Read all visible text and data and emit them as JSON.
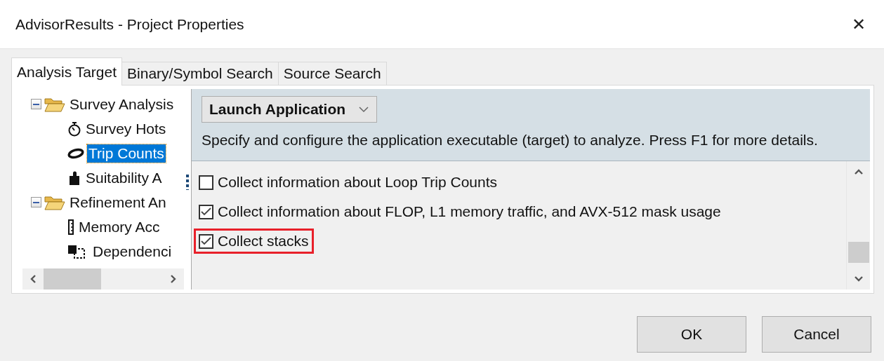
{
  "window": {
    "title": "AdvisorResults - Project Properties",
    "close": "✕"
  },
  "tabs": [
    {
      "label": "Analysis Target",
      "selected": true
    },
    {
      "label": "Binary/Symbol Search",
      "selected": false
    },
    {
      "label": "Source Search",
      "selected": false
    }
  ],
  "tree": [
    {
      "label": "Survey Analysis",
      "expanded": true,
      "selected": false,
      "children": [
        {
          "label": "Survey Hots",
          "selected": false
        },
        {
          "label": "Trip Counts",
          "selected": true
        },
        {
          "label": "Suitability A",
          "selected": false
        }
      ]
    },
    {
      "label": "Refinement An",
      "expanded": true,
      "selected": false,
      "children": [
        {
          "label": "Memory Acc",
          "selected": false
        },
        {
          "label": "Dependenci",
          "selected": false
        }
      ]
    }
  ],
  "target_dropdown": {
    "value": "Launch Application"
  },
  "description": "Specify and configure the application executable (target) to analyze. Press F1 for more details.",
  "options": [
    {
      "label": "Collect information about Loop Trip Counts",
      "checked": false,
      "highlighted": false
    },
    {
      "label": "Collect information about FLOP, L1 memory traffic, and AVX-512 mask usage",
      "checked": true,
      "highlighted": false
    },
    {
      "label": "Collect stacks",
      "checked": true,
      "highlighted": true
    }
  ],
  "buttons": [
    {
      "label": "OK"
    },
    {
      "label": "Cancel"
    }
  ]
}
